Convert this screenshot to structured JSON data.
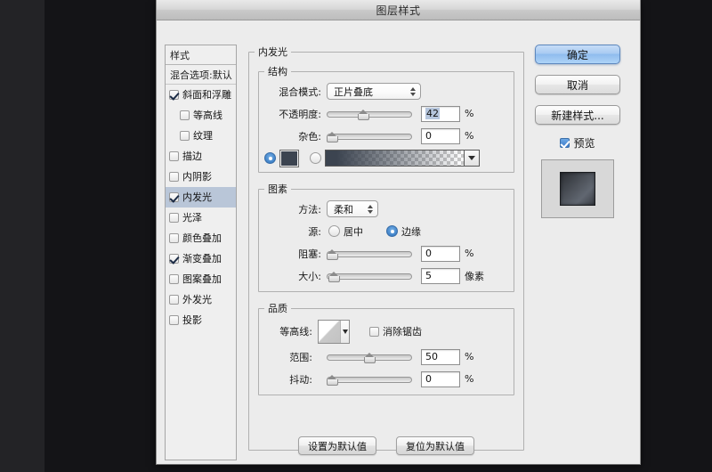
{
  "dialog": {
    "title": "图层样式"
  },
  "sidebar": {
    "header": "样式",
    "blending_options": "混合选项:默认",
    "items": [
      {
        "label": "斜面和浮雕",
        "checked": true,
        "sub": false,
        "selected": false
      },
      {
        "label": "等高线",
        "checked": false,
        "sub": true,
        "selected": false
      },
      {
        "label": "纹理",
        "checked": false,
        "sub": true,
        "selected": false
      },
      {
        "label": "描边",
        "checked": false,
        "sub": false,
        "selected": false
      },
      {
        "label": "内阴影",
        "checked": false,
        "sub": false,
        "selected": false
      },
      {
        "label": "内发光",
        "checked": true,
        "sub": false,
        "selected": true
      },
      {
        "label": "光泽",
        "checked": false,
        "sub": false,
        "selected": false
      },
      {
        "label": "颜色叠加",
        "checked": false,
        "sub": false,
        "selected": false
      },
      {
        "label": "渐变叠加",
        "checked": true,
        "sub": false,
        "selected": false
      },
      {
        "label": "图案叠加",
        "checked": false,
        "sub": false,
        "selected": false
      },
      {
        "label": "外发光",
        "checked": false,
        "sub": false,
        "selected": false
      },
      {
        "label": "投影",
        "checked": false,
        "sub": false,
        "selected": false
      }
    ]
  },
  "main": {
    "panel_title": "内发光",
    "structure": {
      "legend": "结构",
      "blend_mode_label": "混合模式:",
      "blend_mode_value": "正片叠底",
      "opacity_label": "不透明度:",
      "opacity_value": "42",
      "opacity_unit": "%",
      "opacity_percent": 42,
      "noise_label": "杂色:",
      "noise_value": "0",
      "noise_unit": "%",
      "noise_percent": 0,
      "color_mode_selected": "color",
      "color_swatch_hex": "#3c4450",
      "gradient_from_hex": "#3c4450",
      "gradient_to": "transparent"
    },
    "elements": {
      "legend": "图素",
      "technique_label": "方法:",
      "technique_value": "柔和",
      "source_label": "源:",
      "source_center": "居中",
      "source_edge": "边缘",
      "source_selected": "边缘",
      "choke_label": "阻塞:",
      "choke_value": "0",
      "choke_unit": "%",
      "choke_percent": 0,
      "size_label": "大小:",
      "size_value": "5",
      "size_unit": "像素",
      "size_percent": 2
    },
    "quality": {
      "legend": "品质",
      "contour_label": "等高线:",
      "antialias_label": "消除锯齿",
      "antialias_checked": false,
      "range_label": "范围:",
      "range_value": "50",
      "range_unit": "%",
      "range_percent": 50,
      "jitter_label": "抖动:",
      "jitter_value": "0",
      "jitter_unit": "%",
      "jitter_percent": 0
    },
    "make_default_label": "设置为默认值",
    "reset_default_label": "复位为默认值"
  },
  "actions": {
    "ok_label": "确定",
    "cancel_label": "取消",
    "new_style_label": "新建样式...",
    "preview_label": "预览",
    "preview_checked": true
  },
  "colors": {
    "dialog_bg": "#ececec",
    "accent_blue": "#8fbcee",
    "selection_blue": "#b9c6d8",
    "swatch": "#3c4450"
  }
}
